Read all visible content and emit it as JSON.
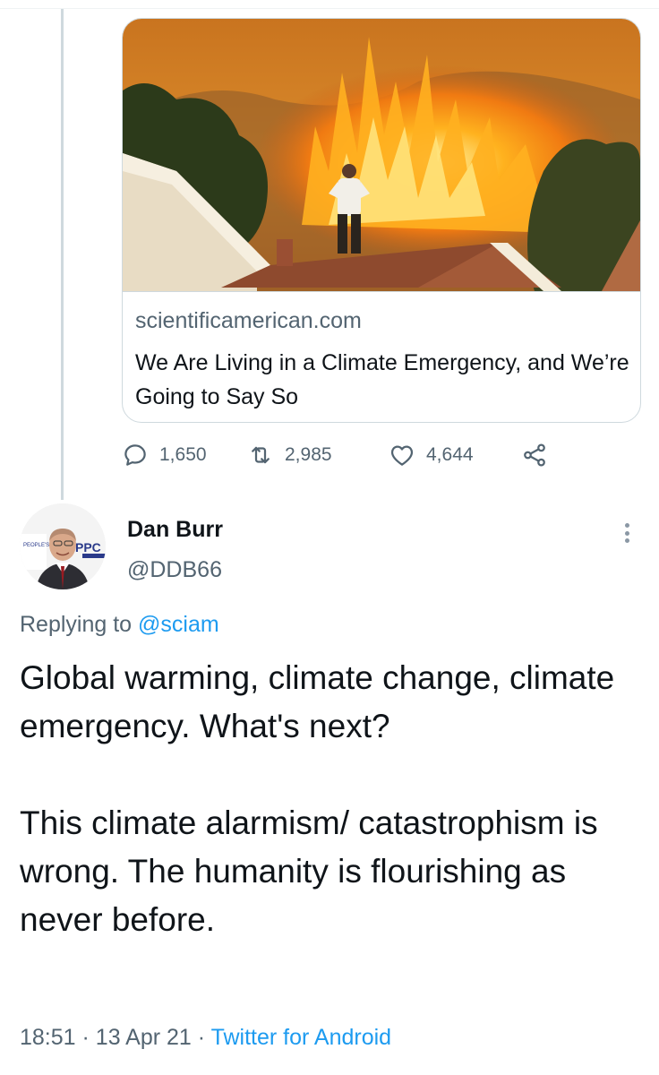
{
  "card": {
    "domain": "scientificamerican.com",
    "title": "We Are Living in a Climate Emergency, and We’re Going to Say So",
    "image_icon": "wildfire-photo"
  },
  "actions": {
    "replies": "1,650",
    "retweets": "2,985",
    "likes": "4,644",
    "reply_icon": "reply-icon",
    "retweet_icon": "retweet-icon",
    "like_icon": "heart-icon",
    "share_icon": "share-icon"
  },
  "reply": {
    "display_name": "Dan Burr",
    "handle": "@DDB66",
    "replying_prefix": "Replying to",
    "replying_to": "@sciam",
    "paragraph1": "Global warming, climate change, climate emergency. What's next?",
    "paragraph2": "This climate alarmism/ catastrophism is wrong. The humanity is flourishing as never before.",
    "time": "18:51",
    "date": "13 Apr 21",
    "separator": "·",
    "source": "Twitter for Android",
    "avatar_logo_text": "PPC",
    "avatar_logo_sub": "PEOPLE'S PARTY"
  },
  "colors": {
    "link_blue": "#1d9bf0",
    "muted_gray": "#536471",
    "border": "#cfd9de"
  }
}
